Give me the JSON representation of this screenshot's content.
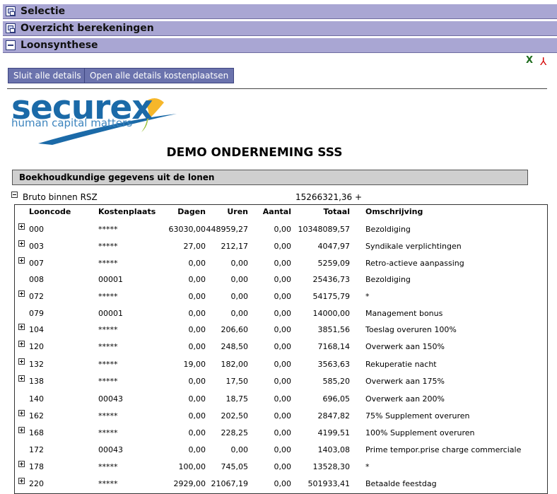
{
  "panels": [
    {
      "title": "Selectie",
      "icon": "restore-window-icon"
    },
    {
      "title": "Overzicht berekeningen",
      "icon": "restore-window-icon"
    },
    {
      "title": "Loonsynthese",
      "icon": "minimize-icon"
    }
  ],
  "export": {
    "excel_icon": "excel-icon",
    "pdf_icon": "pdf-icon",
    "excel_glyph": "X",
    "pdf_glyph": "⅄"
  },
  "buttons": {
    "close_all": "Sluit alle details",
    "open_all": "Open alle details kostenplaatsen"
  },
  "logo": {
    "word": "securex",
    "tagline": "human capital matters"
  },
  "company": "DEMO ONDERNEMING SSS",
  "section_title": "Boekhoudkundige gegevens uit de lonen",
  "group": {
    "label": "Bruto binnen RSZ",
    "total": "15266321,36 +"
  },
  "columns": [
    "Looncode",
    "Kostenplaats",
    "Dagen",
    "Uren",
    "Aantal",
    "Totaal",
    "Omschrijving"
  ],
  "rows": [
    {
      "expand": true,
      "code": "000",
      "cost": "*****",
      "days": "63030,00",
      "hours": "448959,27",
      "qty": "0,00",
      "total": "10348089,57",
      "desc": "Bezoldiging"
    },
    {
      "expand": true,
      "code": "003",
      "cost": "*****",
      "days": "27,00",
      "hours": "212,17",
      "qty": "0,00",
      "total": "4047,97",
      "desc": "Syndikale verplichtingen"
    },
    {
      "expand": true,
      "code": "007",
      "cost": "*****",
      "days": "0,00",
      "hours": "0,00",
      "qty": "0,00",
      "total": "5259,09",
      "desc": "Retro-actieve aanpassing"
    },
    {
      "expand": false,
      "code": "008",
      "cost": "00001",
      "days": "0,00",
      "hours": "0,00",
      "qty": "0,00",
      "total": "25436,73",
      "desc": "Bezoldiging"
    },
    {
      "expand": true,
      "code": "072",
      "cost": "*****",
      "days": "0,00",
      "hours": "0,00",
      "qty": "0,00",
      "total": "54175,79",
      "desc": "*"
    },
    {
      "expand": false,
      "code": "079",
      "cost": "00001",
      "days": "0,00",
      "hours": "0,00",
      "qty": "0,00",
      "total": "14000,00",
      "desc": "Management bonus"
    },
    {
      "expand": true,
      "code": "104",
      "cost": "*****",
      "days": "0,00",
      "hours": "206,60",
      "qty": "0,00",
      "total": "3851,56",
      "desc": "Toeslag overuren 100%"
    },
    {
      "expand": true,
      "code": "120",
      "cost": "*****",
      "days": "0,00",
      "hours": "248,50",
      "qty": "0,00",
      "total": "7168,14",
      "desc": "Overwerk aan 150%"
    },
    {
      "expand": true,
      "code": "132",
      "cost": "*****",
      "days": "19,00",
      "hours": "182,00",
      "qty": "0,00",
      "total": "3563,63",
      "desc": "Rekuperatie nacht"
    },
    {
      "expand": true,
      "code": "138",
      "cost": "*****",
      "days": "0,00",
      "hours": "17,50",
      "qty": "0,00",
      "total": "585,20",
      "desc": "Overwerk aan 175%"
    },
    {
      "expand": false,
      "code": "140",
      "cost": "00043",
      "days": "0,00",
      "hours": "18,75",
      "qty": "0,00",
      "total": "696,05",
      "desc": "Overwerk aan 200%"
    },
    {
      "expand": true,
      "code": "162",
      "cost": "*****",
      "days": "0,00",
      "hours": "202,50",
      "qty": "0,00",
      "total": "2847,82",
      "desc": "75% Supplement overuren"
    },
    {
      "expand": true,
      "code": "168",
      "cost": "*****",
      "days": "0,00",
      "hours": "228,25",
      "qty": "0,00",
      "total": "4199,51",
      "desc": "100% Supplement overuren"
    },
    {
      "expand": false,
      "code": "172",
      "cost": "00043",
      "days": "0,00",
      "hours": "0,00",
      "qty": "0,00",
      "total": "1403,08",
      "desc": "Prime tempor.prise charge commerciale"
    },
    {
      "expand": true,
      "code": "178",
      "cost": "*****",
      "days": "100,00",
      "hours": "745,05",
      "qty": "0,00",
      "total": "13528,30",
      "desc": "*"
    },
    {
      "expand": true,
      "code": "220",
      "cost": "*****",
      "days": "2929,00",
      "hours": "21067,19",
      "qty": "0,00",
      "total": "501933,41",
      "desc": "Betaalde feestdag"
    }
  ]
}
